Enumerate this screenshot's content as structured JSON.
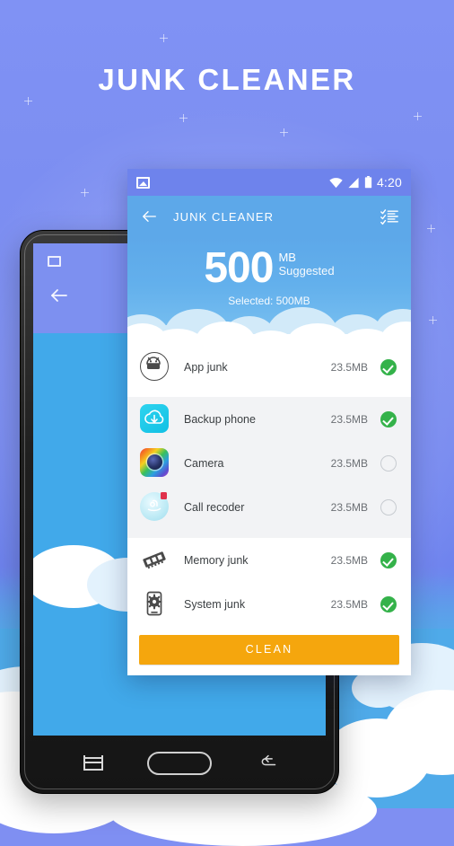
{
  "page": {
    "title": "JUNK CLEANER",
    "background_color": "#7f8ff2",
    "accent_blue": "#5da8e9",
    "accent_orange": "#f5a60d",
    "check_green": "#34b24a"
  },
  "statusbar": {
    "photo_icon": "photo-icon",
    "wifi_icon": "wifi-icon",
    "signal_icon": "signal-icon",
    "battery_icon": "battery-icon",
    "time": "4:20"
  },
  "appbar": {
    "back_icon": "back-arrow-icon",
    "title": "JUNK CLEANER",
    "action_icon": "checklist-icon"
  },
  "hero": {
    "amount": "500",
    "unit": "MB",
    "suggested": "Suggested",
    "selected": "Selected: 500MB"
  },
  "list": {
    "items": [
      {
        "icon": "android-robot-icon",
        "label": "App junk",
        "size": "23.5MB",
        "checked": true
      },
      {
        "icon": "cloud-backup-icon",
        "label": "Backup phone",
        "size": "23.5MB",
        "checked": true
      },
      {
        "icon": "camera-icon",
        "label": "Camera",
        "size": "23.5MB",
        "checked": false
      },
      {
        "icon": "call-recorder-icon",
        "label": "Call recoder",
        "size": "23.5MB",
        "checked": false
      },
      {
        "icon": "memory-ram-icon",
        "label": "Memory junk",
        "size": "23.5MB",
        "checked": true
      },
      {
        "icon": "system-gear-icon",
        "label": "System junk",
        "size": "23.5MB",
        "checked": true
      }
    ]
  },
  "footer": {
    "clean_label": "CLEAN"
  },
  "tablet": {
    "status_icon": "photo-icon",
    "back_icon": "back-arrow-icon",
    "menu_icon": "recent-apps-icon",
    "home_icon": "home-button",
    "nav_back_icon": "back-nav-icon"
  }
}
